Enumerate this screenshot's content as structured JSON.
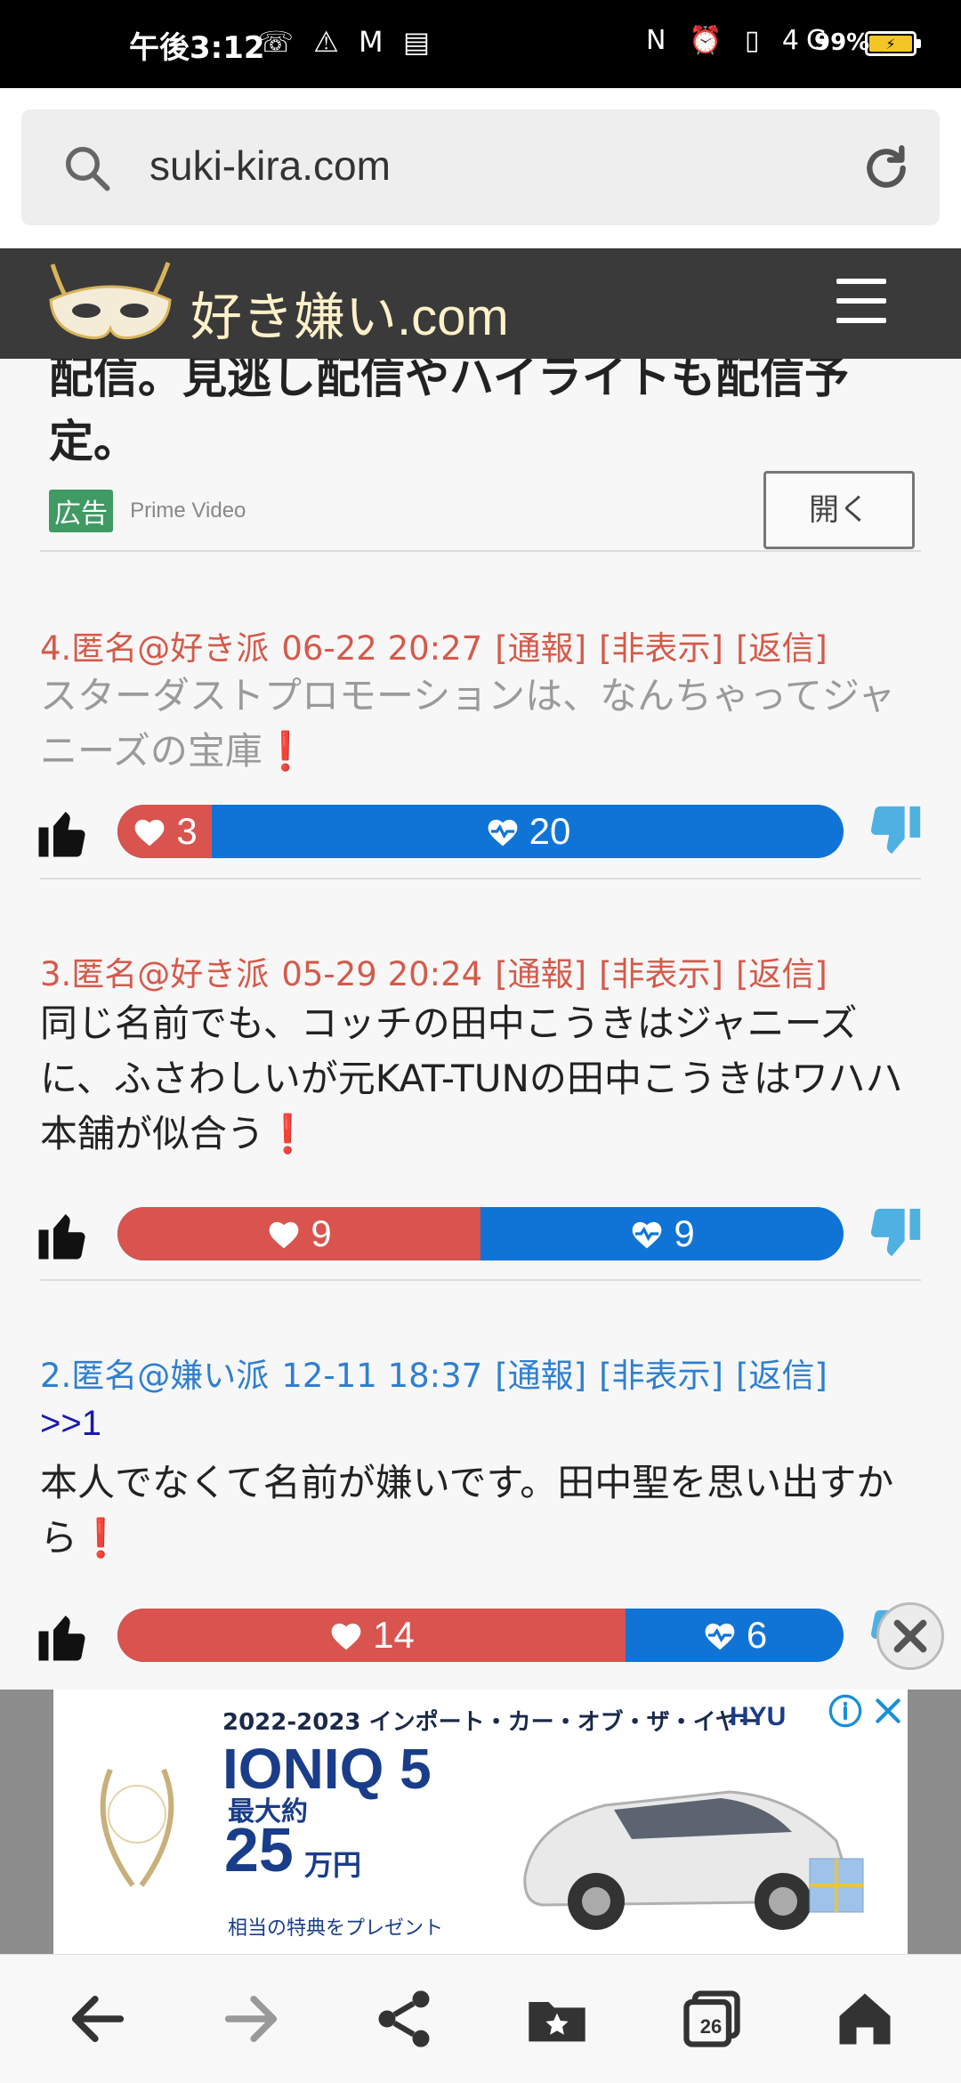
{
  "status_bar": {
    "time": "午後3:12",
    "left_icons": "☏ ⚠ M ▤",
    "right_icons": "N ⏰ ▯ 4G",
    "battery_percent": "99%"
  },
  "browser": {
    "url": "suki-kira.com"
  },
  "site": {
    "logo_text_jp": "好き嫌い",
    "logo_text_dom": ".com"
  },
  "ad": {
    "headline": "配信。見逃し配信やハイライトも配信予定。",
    "badge": "広告",
    "source": "Prime Video",
    "open_button": "開く"
  },
  "comments": [
    {
      "header": {
        "id": "4.匿名@好き派",
        "date": "06-22 20:27",
        "report": "[通報]",
        "hide": "[非表示]",
        "reply": "[返信]"
      },
      "body": "スターダストプロモーションは、なんちゃってジャニーズの宝庫",
      "likes": 3,
      "dislikes": 20,
      "stance": "like"
    },
    {
      "header": {
        "id": "3.匿名@好き派",
        "date": "05-29 20:24",
        "report": "[通報]",
        "hide": "[非表示]",
        "reply": "[返信]"
      },
      "body": "同じ名前でも、コッチの田中こうきはジャニーズに、ふさわしいが元KAT-TUNの田中こうきはワハハ本舗が似合う",
      "likes": 9,
      "dislikes": 9,
      "stance": "like"
    },
    {
      "header": {
        "id": "2.匿名@嫌い派",
        "date": "12-11 18:37",
        "report": "[通報]",
        "hide": "[非表示]",
        "reply": "[返信]"
      },
      "reply_ref": ">>1",
      "body": "本人でなくて名前が嫌いです。田中聖を思い出すから",
      "likes": 14,
      "dislikes": 6,
      "stance": "hate"
    }
  ],
  "banner_ad": {
    "year_line": "2022-2023 インポート・カー・オブ・ザ・イヤー",
    "model": "IONIQ 5",
    "max_label": "最大約",
    "amount": "25",
    "unit": "万円",
    "sub": "相当の特典をプレゼント",
    "brand": "HYU"
  },
  "bottom_nav": {
    "tab_count": "26"
  },
  "colors": {
    "like": "#d9534f",
    "dislike": "#0f74d6",
    "like_text": "#d45a4a",
    "hate_text": "#2f7fd0",
    "header_bg": "#3a3a3a"
  }
}
